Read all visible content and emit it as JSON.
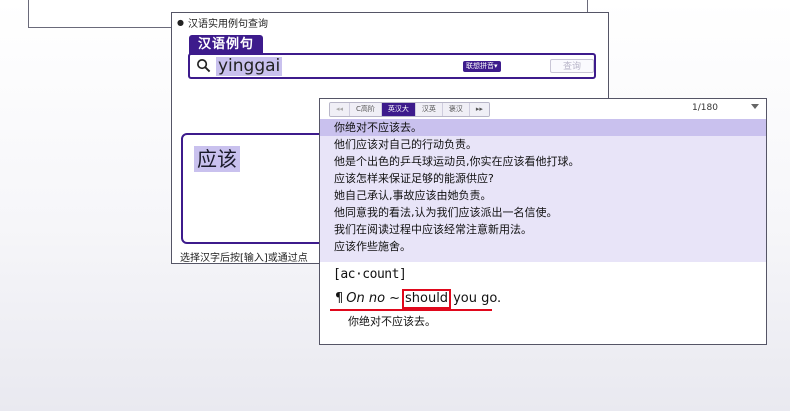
{
  "background_window": {},
  "search_window": {
    "title": "汉语实用例句查询",
    "tab_label": "汉语例句",
    "search": {
      "value": "yinggai",
      "mode_label": "联想拼音▾",
      "query_label": "查询"
    },
    "selected_word": "应该",
    "status_text": "选择汉字后按[输入]或通过点"
  },
  "results_window": {
    "tabs": [
      {
        "label": "◂◂"
      },
      {
        "label": "C高阶"
      },
      {
        "label": "英汉大"
      },
      {
        "label": "汉英"
      },
      {
        "label": "褒汉"
      },
      {
        "label": "▸▸"
      }
    ],
    "active_tab": "英汉大",
    "page_counter": "1/180",
    "sentences": [
      "你绝对不应该去。",
      "他们应该对自己的行动负责。",
      "他是个出色的乒乓球运动员,你实在应该看他打球。",
      "应该怎样来保证足够的能源供应?",
      "她自己承认,事故应该由她负责。",
      "他同意我的看法,认为我们应该派出一名信使。",
      "我们在阅读过程中应该经常注意新用法。",
      "应该作些施舍。"
    ],
    "entry": {
      "headword": "[ac·count]",
      "example": {
        "pilcrow": "¶",
        "lead": "On no",
        "tilde": "~",
        "highlight": "should",
        "rest": "you go."
      },
      "translation": "你绝对不应该去。"
    }
  },
  "colors": {
    "accent": "#3d1b8c",
    "selection": "#c9c1ee",
    "list_background": "#e8e4f8",
    "highlight_red": "#e0081c"
  }
}
